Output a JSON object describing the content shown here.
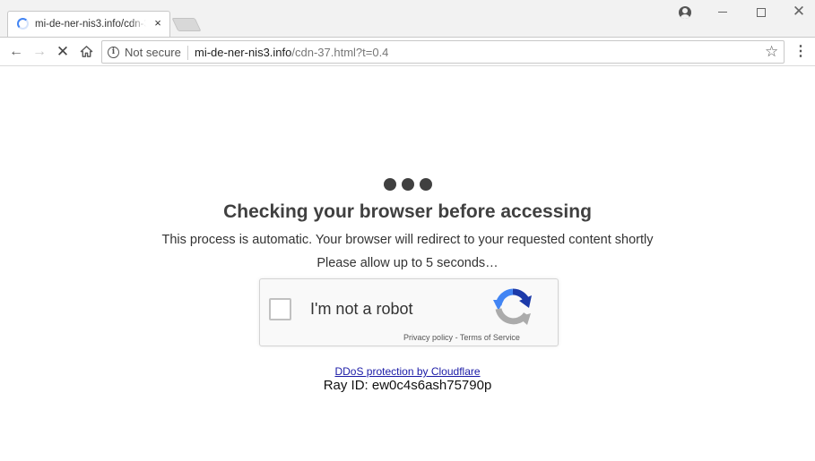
{
  "browser": {
    "tab": {
      "title": "mi-de-ner-nis3.info/cdn-37.html?t=0.4",
      "close_label": "×"
    },
    "window_controls": {
      "profile_icon": "profile-icon",
      "minimize_icon": "minimize-icon",
      "maximize_icon": "maximize-icon",
      "close_icon": "close-icon"
    },
    "toolbar": {
      "back_icon": "←",
      "forward_icon": "→",
      "stop_icon": "✕",
      "home_icon": "⌂",
      "security_label": "Not secure",
      "url_host": "mi-de-ner-nis3.info",
      "url_path": "/cdn-37.html?t=0.4",
      "bookmark_icon": "☆",
      "menu_icon": "⋮"
    }
  },
  "page": {
    "heading": "Checking your browser before accessing",
    "description": "This process is automatic. Your browser will redirect to your requested content shortly",
    "wait_message": "Please allow up to 5 seconds…",
    "recaptcha": {
      "checkbox_label": "I'm not a robot",
      "privacy_link": "Privacy policy",
      "separator": " - ",
      "terms_link": "Terms of Service"
    },
    "ddos_link": "DDoS protection by Cloudflare",
    "ray_id": "Ray ID: ew0c4s6ash75790p"
  },
  "colors": {
    "heading": "#404040",
    "link": "#1a1aa6",
    "recaptcha_blue": "#4a90e2",
    "recaptcha_gray": "#b6b6b6",
    "loading_spinner": "#4285f4"
  }
}
